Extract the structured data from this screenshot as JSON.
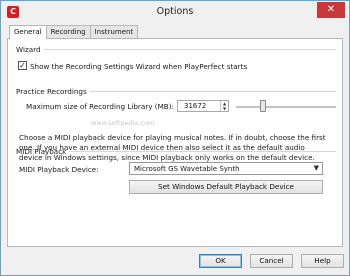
{
  "window": {
    "title": "Options",
    "app_icon_letter": "C",
    "close_glyph": "✕"
  },
  "tabs": [
    {
      "label": "General",
      "active": true
    },
    {
      "label": "Recording",
      "active": false
    },
    {
      "label": "Instrument",
      "active": false
    }
  ],
  "wizard": {
    "group_title": "Wizard",
    "checkbox_checked": true,
    "checkbox_label": "Show the Recording Settings Wizard when PlayPerfect starts"
  },
  "practice": {
    "group_title": "Practice Recordings",
    "max_size_label": "Maximum size of Recording Library (MB):",
    "max_size_value": "31672",
    "slider_level_percent": 26,
    "watermark": "www.softpedia.com"
  },
  "midi": {
    "group_title": "MIDI Playback",
    "description": "Choose a MIDI playback device for playing musical notes. If in doubt, choose the first one. If you have an external MIDI device then also select it as the default audio device in Windows settings, since MIDI playback only works on the default device.",
    "device_label": "MIDI Playback Device:",
    "device_value": "Microsoft GS Wavetable Synth",
    "set_default_button": "Set Windows Default Playback Device"
  },
  "footer": {
    "ok": "OK",
    "cancel": "Cancel",
    "help": "Help"
  },
  "colors": {
    "close_button": "#c8383a",
    "app_icon": "#d62020",
    "window_border": "#6fa0c9"
  }
}
